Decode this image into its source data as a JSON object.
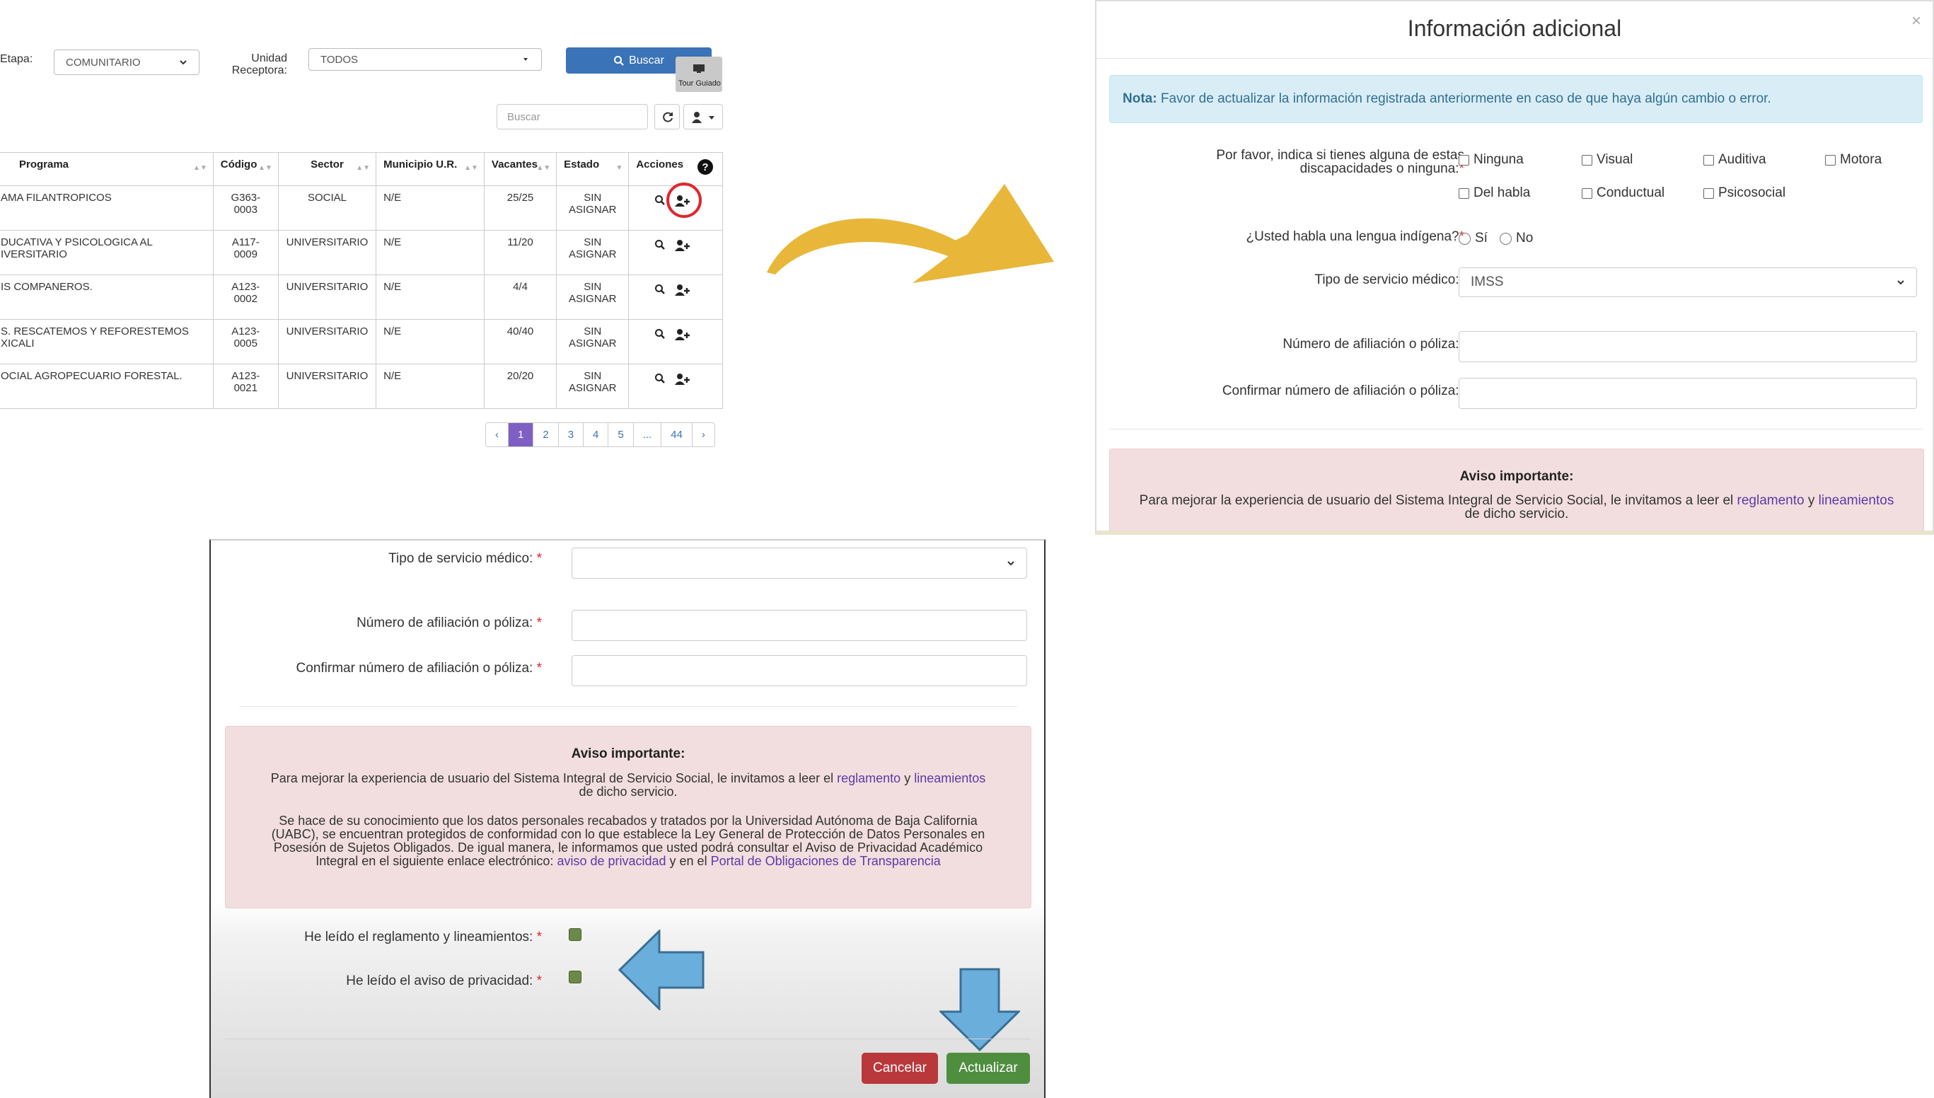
{
  "panel1": {
    "etapa_label": "Etapa:",
    "etapa_value": "COMUNITARIO",
    "unidad_label_1": "Unidad",
    "unidad_label_2": "Receptora:",
    "unidad_value": "TODOS",
    "buscar_button": "Buscar",
    "tour_label": "Tour Guiado",
    "search_placeholder": "Buscar",
    "columns": [
      "Programa",
      "Código",
      "Sector",
      "Municipio U.R.",
      "Vacantes",
      "Estado",
      "Acciones"
    ],
    "rows": [
      {
        "programa": "AMA FILANTROPICOS",
        "codigo": "G363-0003",
        "sector": "SOCIAL",
        "municipio": "N/E",
        "vacantes": "25/25",
        "estado": "SIN ASIGNAR"
      },
      {
        "programa": "DUCATIVA Y PSICOLOGICA AL IVERSITARIO",
        "codigo": "A117-0009",
        "sector": "UNIVERSITARIO",
        "municipio": "N/E",
        "vacantes": "11/20",
        "estado": "SIN ASIGNAR"
      },
      {
        "programa": "IS COMPANEROS.",
        "codigo": "A123-0002",
        "sector": "UNIVERSITARIO",
        "municipio": "N/E",
        "vacantes": "4/4",
        "estado": "SIN ASIGNAR"
      },
      {
        "programa": "S. RESCATEMOS Y REFORESTEMOS XICALI",
        "codigo": "A123-0005",
        "sector": "UNIVERSITARIO",
        "municipio": "N/E",
        "vacantes": "40/40",
        "estado": "SIN ASIGNAR"
      },
      {
        "programa": "OCIAL AGROPECUARIO FORESTAL.",
        "codigo": "A123-0021",
        "sector": "UNIVERSITARIO",
        "municipio": "N/E",
        "vacantes": "20/20",
        "estado": "SIN ASIGNAR"
      }
    ],
    "pagination": [
      "‹",
      "1",
      "2",
      "3",
      "4",
      "5",
      "...",
      "44",
      "›"
    ]
  },
  "modal": {
    "title": "Información adicional",
    "close": "×",
    "note_bold": "Nota:",
    "note_text": " Favor de actualizar la información registrada anteriormente en caso de que haya algún cambio o error.",
    "discap_label_1": "Por favor, indica si tienes alguna de estas",
    "discap_label_2": "discapacidades o ninguna:",
    "discap_options": [
      "Ninguna",
      "Visual",
      "Auditiva",
      "Motora",
      "Del habla",
      "Conductual",
      "Psicosocial"
    ],
    "lengua_label": "¿Usted habla una lengua indígena?",
    "lengua_options": [
      "Sí",
      "No"
    ],
    "servicio_label": "Tipo de servicio médico:",
    "servicio_value": "IMSS",
    "afiliacion_label": "Número de afiliación o póliza:",
    "confirmar_label": "Confirmar número de afiliación o póliza:",
    "aviso_title": "Aviso importante:",
    "aviso_text_1": "Para mejorar la experiencia de usuario del Sistema Integral de Servicio Social, le invitamos a leer el ",
    "link_reglamento": "reglamento",
    "and": " y ",
    "link_lineamientos": "lineamientos",
    "aviso_text_2": "de dicho servicio.",
    "required": "*"
  },
  "panel3": {
    "servicio_label": "Tipo de servicio médico:",
    "afiliacion_label": "Número de afiliación o póliza:",
    "confirmar_label": "Confirmar número de afiliación o póliza:",
    "aviso_title": "Aviso importante:",
    "aviso_p1": "Para mejorar la experiencia de usuario del Sistema Integral de Servicio Social, le invitamos a leer el ",
    "link_reglamento": "reglamento",
    "and": " y ",
    "link_lineamientos": "lineamientos",
    "aviso_p1_end": "de dicho servicio.",
    "privacy_l1": "Se hace de su conocimiento que los datos personales recabados y tratados por la Universidad Autónoma de Baja California",
    "privacy_l2": "(UABC), se encuentran protegidos de conformidad con lo que establece la Ley General de Protección de Datos Personales en",
    "privacy_l3": "Posesión de Sujetos Obligados. De igual manera, le informamos que usted podrá consultar el Aviso de Privacidad Académico",
    "privacy_l4": "Integral en el siguiente enlace electrónico: ",
    "link_aviso": "aviso de privacidad",
    "privacy_and": " y en el ",
    "link_portal": "Portal de Obligaciones de Transparencia",
    "leido_reglamento": "He leído el reglamento y lineamientos:",
    "leido_aviso": "He leído el aviso de privacidad:",
    "cancel_button": "Cancelar",
    "update_button": "Actualizar",
    "required": "*"
  },
  "colors": {
    "annotation_arrow": "#e8b73a",
    "pointer_arrow": "#6aaedb",
    "highlight_circle": "#e0262e"
  }
}
